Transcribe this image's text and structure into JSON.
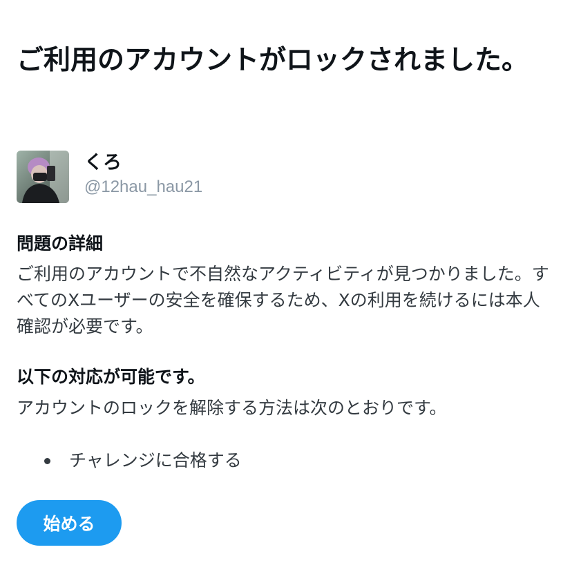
{
  "title": "ご利用のアカウントがロックされました。",
  "account": {
    "display_name": "くろ",
    "handle": "@12hau_hau21"
  },
  "details": {
    "heading": "問題の詳細",
    "body": "ご利用のアカウントで不自然なアクティビティが見つかりました。すべてのXユーザーの安全を確保するため、Xの利用を続けるには本人確認が必要です。"
  },
  "options": {
    "heading": "以下の対応が可能です。",
    "body": "アカウントのロックを解除する方法は次のとおりです。",
    "items": [
      "チャレンジに合格する"
    ]
  },
  "start_button": {
    "label": "始める"
  },
  "colors": {
    "accent": "#1d9bf0",
    "text_primary": "#0f1419",
    "text_secondary": "#333a40",
    "handle": "#8b98a5"
  }
}
